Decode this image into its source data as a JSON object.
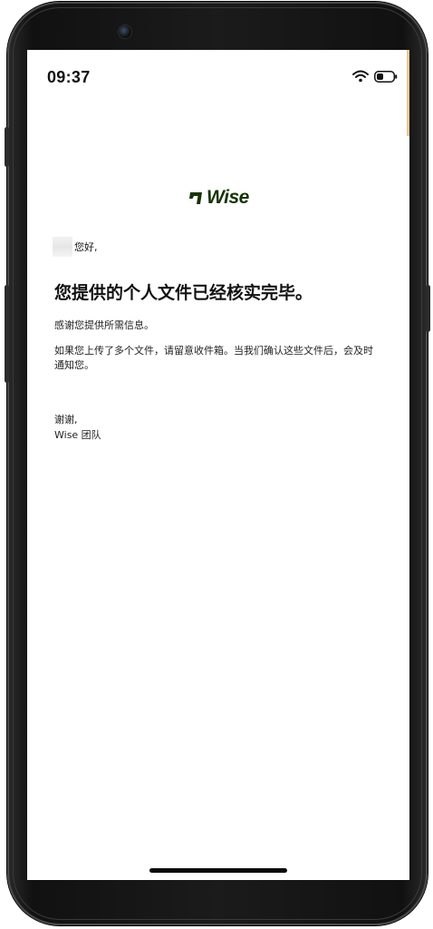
{
  "status_bar": {
    "time": "09:37",
    "icons": [
      "wifi-icon",
      "battery-icon"
    ]
  },
  "email": {
    "brand": "Wise",
    "greeting": "您好,",
    "headline": "您提供的个人文件已经核实完毕。",
    "body": [
      "感谢您提供所需信息。",
      "如果您上传了多个文件，请留意收件箱。当我们确认这些文件后，会及时通知您。"
    ],
    "signoff": "谢谢,",
    "signature": "Wise 团队"
  },
  "colors": {
    "brand_green": "#163300",
    "text": "#111111",
    "frame": "#1b1b1b"
  }
}
